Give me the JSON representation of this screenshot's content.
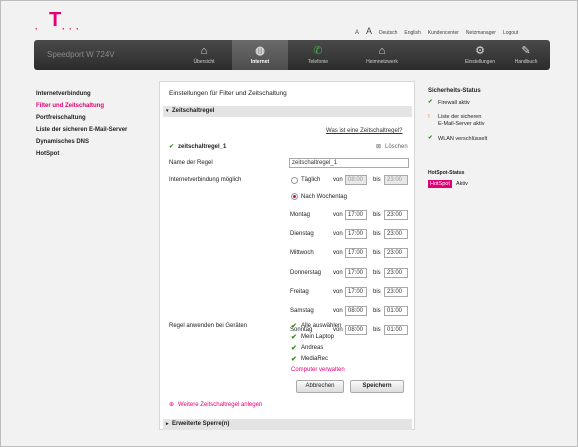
{
  "header": {
    "font_small": "A",
    "font_large": "A",
    "links": [
      "Deutsch",
      "English",
      "Kundencenter",
      "Netzmanager",
      "Logout"
    ]
  },
  "nav": {
    "product": "Speedport W 724V",
    "items": [
      {
        "label": "Übersicht",
        "icon": "house-icon"
      },
      {
        "label": "Internet",
        "icon": "globe-icon"
      },
      {
        "label": "Telefonie",
        "icon": "phone-icon"
      },
      {
        "label": "Heimnetzwerk",
        "icon": "home-network-icon"
      },
      {
        "label": "Einstellungen",
        "icon": "gear-icon"
      },
      {
        "label": "Handbuch",
        "icon": "book-icon"
      }
    ]
  },
  "sidebar": {
    "items": [
      "Internetverbindung",
      "Filter und Zeitschaltung",
      "Portfreischaltung",
      "Liste der sicheren E-Mail-Server",
      "Dynamisches DNS",
      "HotSpot"
    ]
  },
  "main": {
    "title": "Einstellungen für Filter und Zeitschaltung",
    "section1": "Zeitschaltregel",
    "help_link": "Was ist eine Zeitschaltregel?",
    "rule_name_header": "zeitschaltregel_1",
    "delete_label": "Löschen",
    "name_label": "Name der Regel",
    "name_value": "zeitschaltregel_1",
    "internet_label": "Internetverbindung möglich",
    "daily_label": "Täglich",
    "von": "von",
    "bis": "bis",
    "daily_from": "08:00",
    "daily_to": "23:00",
    "weekday_label": "Nach Wochentag",
    "days": [
      {
        "name": "Montag",
        "from": "17:00",
        "to": "23:00"
      },
      {
        "name": "Dienstag",
        "from": "17:00",
        "to": "23:00"
      },
      {
        "name": "Mittwoch",
        "from": "17:00",
        "to": "23:00"
      },
      {
        "name": "Donnerstag",
        "from": "17:00",
        "to": "23:00"
      },
      {
        "name": "Freitag",
        "from": "17:00",
        "to": "23:00"
      },
      {
        "name": "Samstag",
        "from": "08:00",
        "to": "01:00"
      },
      {
        "name": "Sonntag",
        "from": "08:00",
        "to": "01:00"
      }
    ],
    "devices_label": "Regel anwenden bei Geräten",
    "devices": [
      "Alle auswählen",
      "Mein Laptop",
      "Andreas",
      "MediaRec"
    ],
    "manage_link": "Computer verwalten",
    "cancel": "Abbrechen",
    "save": "Speichern",
    "add_rule": "Weitere Zeitschaltregel anlegen",
    "section2": "Erweiterte Sperre(n)"
  },
  "status": {
    "title": "Sicherheits-Status",
    "items": [
      "Firewall aktiv",
      "Liste der sicheren",
      "E-Mail-Server aktiv",
      "WLAN verschlüsselt"
    ],
    "hotspot_title": "HotSpot-Status",
    "hotspot_badge": "HotSpot",
    "hotspot_state": "Aktiv"
  },
  "colors": {
    "accent": "#e20074",
    "ok": "#3a8a1a",
    "nav": "#333333"
  }
}
